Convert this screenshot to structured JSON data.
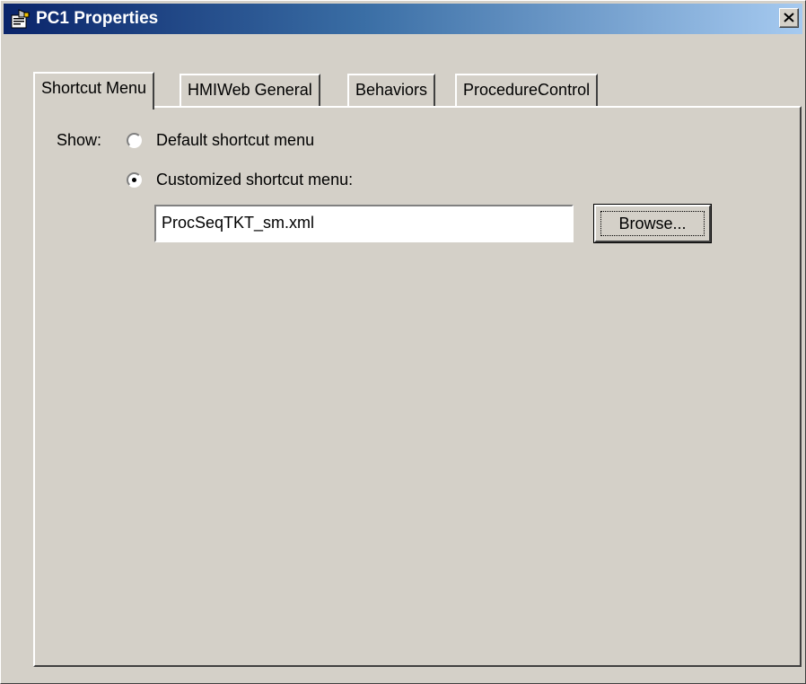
{
  "window": {
    "title": "PC1 Properties",
    "icon": "properties-icon",
    "close_icon": "close-icon"
  },
  "tabs": [
    {
      "label": "Shortcut Menu",
      "active": true
    },
    {
      "label": "HMIWeb General",
      "active": false
    },
    {
      "label": "Behaviors",
      "active": false
    },
    {
      "label": "ProcedureControl",
      "active": false
    }
  ],
  "shortcut_menu": {
    "show_label": "Show:",
    "options": [
      {
        "label": "Default shortcut menu",
        "selected": false
      },
      {
        "label": "Customized shortcut menu:",
        "selected": true
      }
    ],
    "file_value": "ProcSeqTKT_sm.xml",
    "browse_label": "Browse..."
  },
  "colors": {
    "face": "#d4d0c8",
    "title_start": "#0a246a",
    "title_end": "#a6caf0"
  }
}
